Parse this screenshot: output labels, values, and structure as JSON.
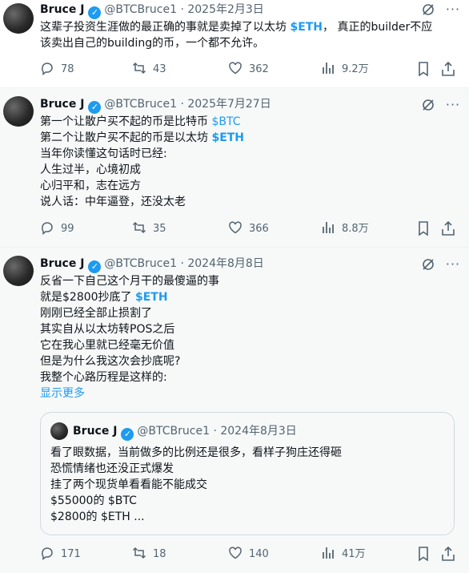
{
  "tweets": [
    {
      "author": {
        "name": "Bruce J",
        "handle": "@BTCBruce1"
      },
      "date": "2025年2月3日",
      "text_parts": [
        "这辈子投资生涯做的最正确的事就是卖掉了以太坊 ",
        "$ETH",
        "， 真正的builder不应",
        "该卖出自己的building的币，一个都不允许。"
      ],
      "stats": {
        "replies": "78",
        "reposts": "43",
        "likes": "362",
        "views": "9.2万"
      }
    },
    {
      "author": {
        "name": "Bruce J",
        "handle": "@BTCBruce1"
      },
      "date": "2025年7月27日",
      "lines": [
        {
          "pre": "第一个让散户买不起的币是比特币 ",
          "cash": "$BTC"
        },
        {
          "pre": "第二个让散户买不起的币是以太坊 ",
          "cash": "$ETH"
        },
        {
          "pre": "当年你读懂这句话时已经:"
        },
        {
          "pre": "人生过半，心境初成"
        },
        {
          "pre": "心归平和，志在远方"
        },
        {
          "pre": "说人话：中年逼登，还没太老"
        }
      ],
      "stats": {
        "replies": "99",
        "reposts": "35",
        "likes": "366",
        "views": "8.8万"
      }
    },
    {
      "author": {
        "name": "Bruce J",
        "handle": "@BTCBruce1"
      },
      "date": "2024年8月8日",
      "lines": [
        {
          "pre": "反省一下自己这个月干的最傻逼的事"
        },
        {
          "pre": "就是$2800抄底了 ",
          "cash": "$ETH"
        },
        {
          "pre": "刚刚已经全部止损割了"
        },
        {
          "pre": "其实自从以太坊转POS之后"
        },
        {
          "pre": "它在我心里就已经毫无价值"
        },
        {
          "pre": "但是为什么我这次会抄底呢?"
        },
        {
          "pre": "我整个心路历程是这样的:"
        }
      ],
      "show_more": "显示更多",
      "quote": {
        "author": {
          "name": "Bruce J",
          "handle": "@BTCBruce1"
        },
        "date": "2024年8月3日",
        "lines": [
          "看了眼数据，当前做多的比例还是很多，看样子狗庄还得砸",
          "恐慌情绪也还没正式爆发",
          "挂了两个现货单看看能不能成交",
          "$55000的 $BTC",
          "$2800的 $ETH ..."
        ]
      },
      "stats": {
        "replies": "171",
        "reposts": "18",
        "likes": "140",
        "views": "41万"
      }
    }
  ],
  "header_separator": "·",
  "colors": {
    "accent": "#1d9bf0",
    "muted": "#536471",
    "text": "#0f1419"
  }
}
